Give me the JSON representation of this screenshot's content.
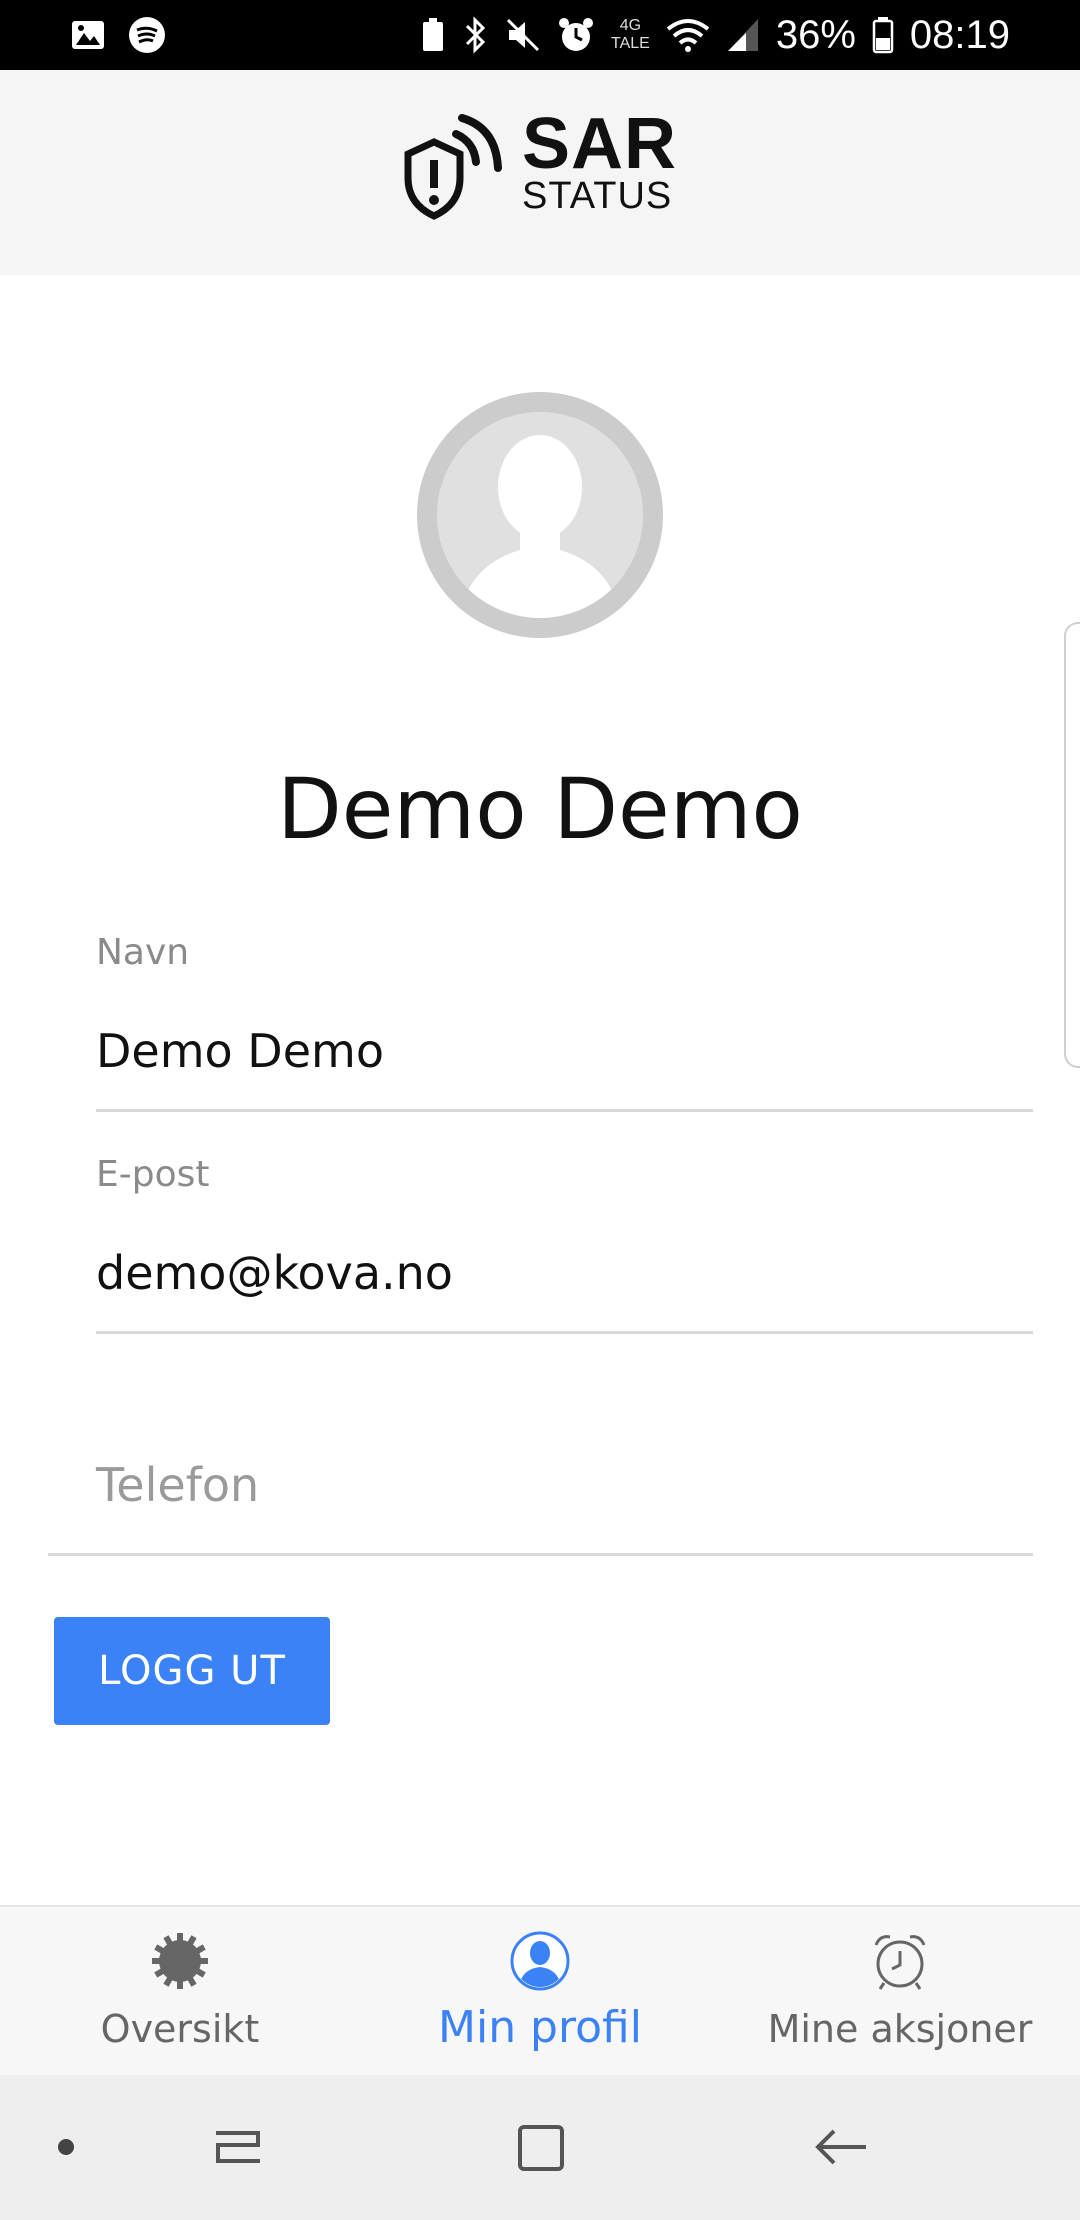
{
  "status_bar": {
    "network_top": "4G",
    "network_bottom": "TALE",
    "battery": "36%",
    "time": "08:19"
  },
  "header": {
    "logo_title": "SAR",
    "logo_subtitle": "STATUS"
  },
  "profile": {
    "display_name": "Demo Demo",
    "fields": {
      "name_label": "Navn",
      "name_value": "Demo Demo",
      "email_label": "E-post",
      "email_value": "demo@kova.no",
      "phone_placeholder": "Telefon"
    },
    "logout_label": "LOGG UT"
  },
  "tabs": [
    {
      "label": "Oversikt",
      "icon": "gear-icon",
      "active": false
    },
    {
      "label": "Min profil",
      "icon": "person-icon",
      "active": true
    },
    {
      "label": "Mine aksjoner",
      "icon": "alarm-clock-icon",
      "active": false
    }
  ],
  "colors": {
    "accent": "#3b82f6",
    "header_bg": "#f5f5f5",
    "status_bar_bg": "#000000"
  }
}
